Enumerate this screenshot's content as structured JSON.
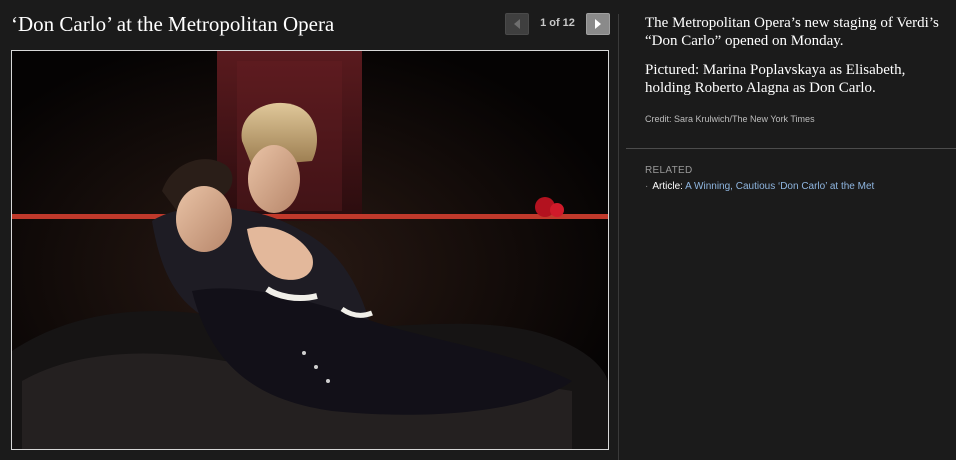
{
  "gallery": {
    "title": "‘Don Carlo’ at the Metropolitan Opera",
    "counter": "1 of 12",
    "prev_icon": "chevron-left-icon",
    "next_icon": "chevron-right-icon"
  },
  "photo": {
    "subject": "opera-stage-photo"
  },
  "caption": {
    "paragraph1": "The Metropolitan Opera’s new staging of Verdi’s “Don Carlo” opened on Monday.",
    "paragraph2": "Pictured: Marina Poplavskaya as Elisabeth, holding Roberto Alagna as Don Carlo.",
    "credit": "Credit: Sara Krulwich/The New York Times"
  },
  "related": {
    "heading": "RELATED",
    "items": [
      {
        "bullet": "·",
        "prefix": "Article:",
        "link": "A Winning, Cautious ‘Don Carlo’ at the Met"
      }
    ]
  },
  "colors": {
    "background": "#1b1b1b",
    "link": "#8fb6e0",
    "muted": "#9a9a9a"
  }
}
